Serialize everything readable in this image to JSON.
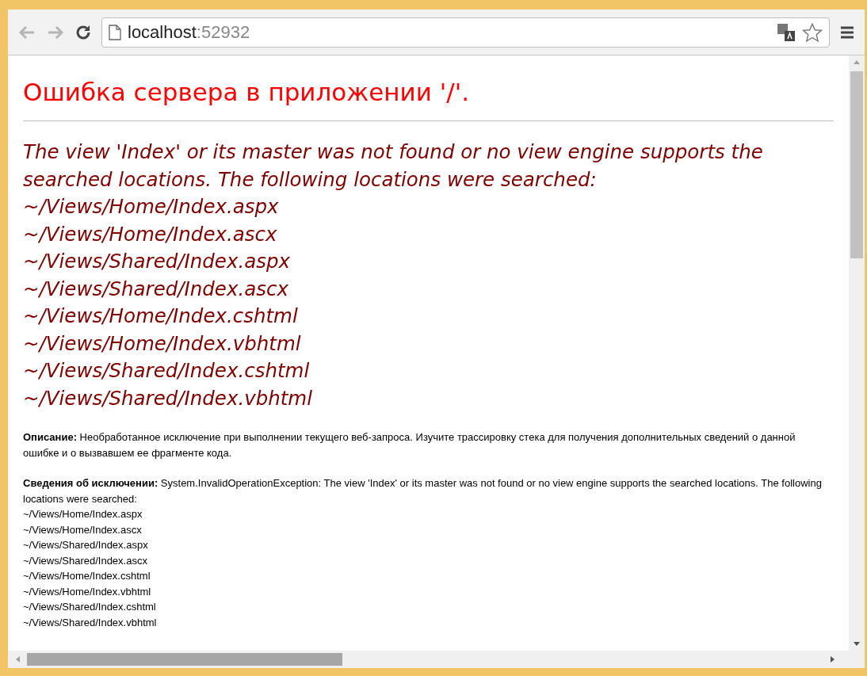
{
  "address_bar": {
    "host": "localhost",
    "port": ":52932"
  },
  "page": {
    "heading": "Ошибка сервера в приложении '/'.",
    "message": "The view 'Index' or its master was not found or no view engine supports the searched locations. The following locations were searched:",
    "locations": [
      "~/Views/Home/Index.aspx",
      "~/Views/Home/Index.ascx",
      "~/Views/Shared/Index.aspx",
      "~/Views/Shared/Index.ascx",
      "~/Views/Home/Index.cshtml",
      "~/Views/Home/Index.vbhtml",
      "~/Views/Shared/Index.cshtml",
      "~/Views/Shared/Index.vbhtml"
    ],
    "description": "**Описание:** Необработанное исключение при выполнении текущего веб-запроса. Изучите трассировку стека для получения дополнительных сведений о данной ошибке и о вызвавшем ее фрагменте кода.",
    "exception": "**Сведения об исключении:** System.InvalidOperationException: The view 'Index' or its master was not found or no view engine supports the searched locations. The following locations were searched:",
    "exception_locations": [
      "~/Views/Home/Index.aspx",
      "~/Views/Home/Index.ascx",
      "~/Views/Shared/Index.aspx",
      "~/Views/Shared/Index.ascx",
      "~/Views/Home/Index.cshtml",
      "~/Views/Home/Index.vbhtml",
      "~/Views/Shared/Index.cshtml",
      "~/Views/Shared/Index.vbhtml"
    ]
  }
}
